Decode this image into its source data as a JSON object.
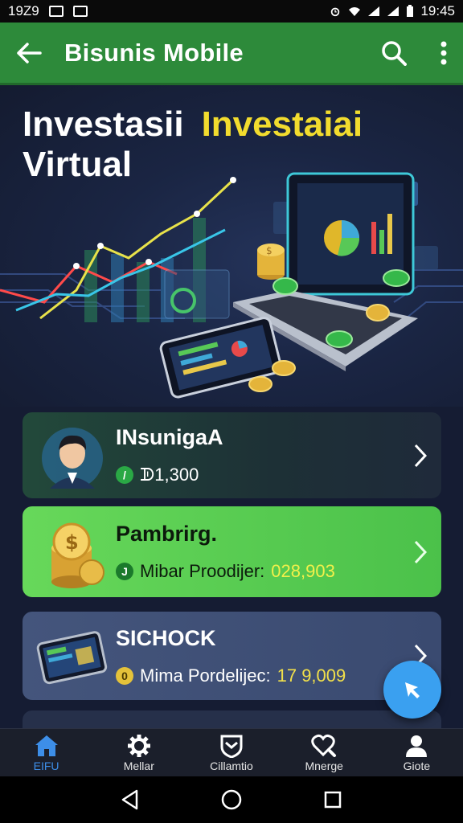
{
  "status_bar": {
    "time_left": "19Z9",
    "time_right": "19:45"
  },
  "app_bar": {
    "title": "Bisunis Mobile",
    "icons": [
      "back-arrow-icon",
      "search-icon",
      "more-vert-icon"
    ]
  },
  "hero": {
    "title_white": "Investasii",
    "title_yellow": "Investaiai",
    "title_line2": "Virtual"
  },
  "cards": [
    {
      "name": "INsunigaA",
      "badge": "/",
      "meta": "ᗫ1,300",
      "meta_value": ""
    },
    {
      "name": "Pambrirg.",
      "badge": "J",
      "meta": "Mibar Proodijer:",
      "meta_value": "028,903"
    },
    {
      "name": "SICHOCK",
      "badge": "0",
      "meta": "Mima Pordelijec:",
      "meta_value": "17 9,009"
    }
  ],
  "bottom_nav": [
    {
      "label": "EIFU",
      "icon": "home-icon"
    },
    {
      "label": "Mellar",
      "icon": "gear-icon"
    },
    {
      "label": "Cillamtio",
      "icon": "shield-icon"
    },
    {
      "label": "Mnerge",
      "icon": "heart-search-icon"
    },
    {
      "label": "Giote",
      "icon": "user-icon"
    }
  ],
  "colors": {
    "app_bar": "#2d8a3a",
    "accent_blue": "#3aa0f0",
    "yellow": "#f2dc2e",
    "green_card": "#5ccf52"
  }
}
